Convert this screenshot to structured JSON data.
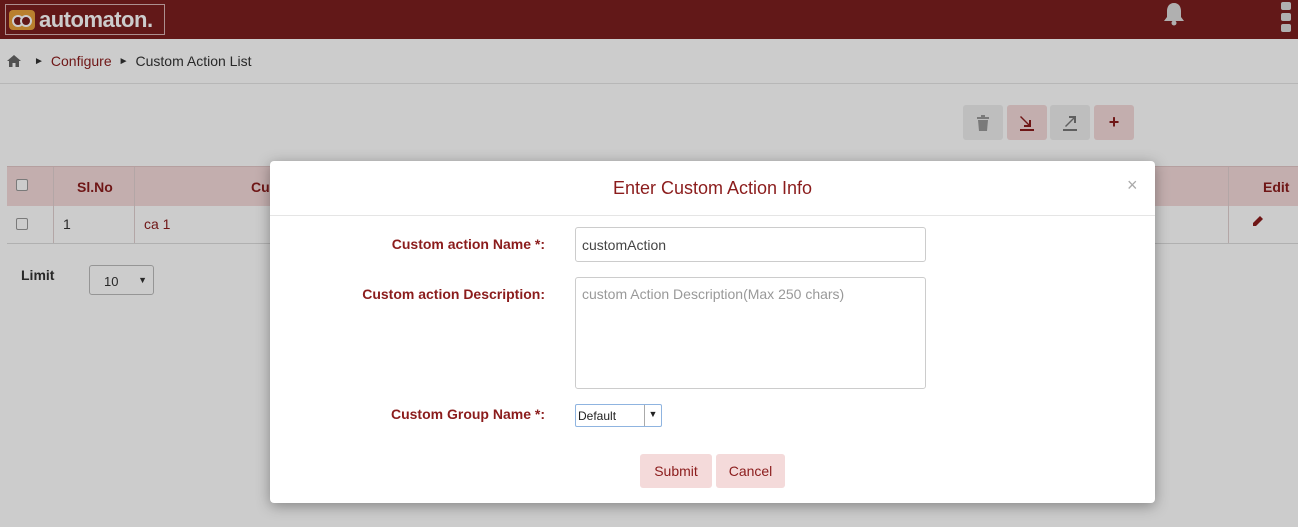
{
  "app": {
    "name": "automaton."
  },
  "breadcrumb": {
    "items": [
      "Configure",
      "Custom Action List"
    ]
  },
  "table": {
    "headers": [
      "Sl.No",
      "Cu",
      "Edit"
    ],
    "rows": [
      {
        "slno": "1",
        "name": "ca 1"
      }
    ]
  },
  "pagination": {
    "limit_label": "Limit",
    "limit_value": "10"
  },
  "modal": {
    "title": "Enter Custom Action Info",
    "close": "×",
    "name_label": "Custom action Name *:",
    "name_value": "customAction",
    "desc_label": "Custom action Description:",
    "desc_placeholder": "custom Action Description(Max 250 chars)",
    "group_label": "Custom Group Name *:",
    "group_value": "Default",
    "submit_label": "Submit",
    "cancel_label": "Cancel"
  },
  "colors": {
    "brand": "#7b1f1f",
    "accent": "#8b1c1c",
    "header_bg": "#f4dada"
  },
  "icons": [
    "home-icon",
    "bell-icon",
    "menu-icon",
    "delete-icon",
    "import-icon",
    "export-icon",
    "add-icon",
    "edit-icon"
  ]
}
